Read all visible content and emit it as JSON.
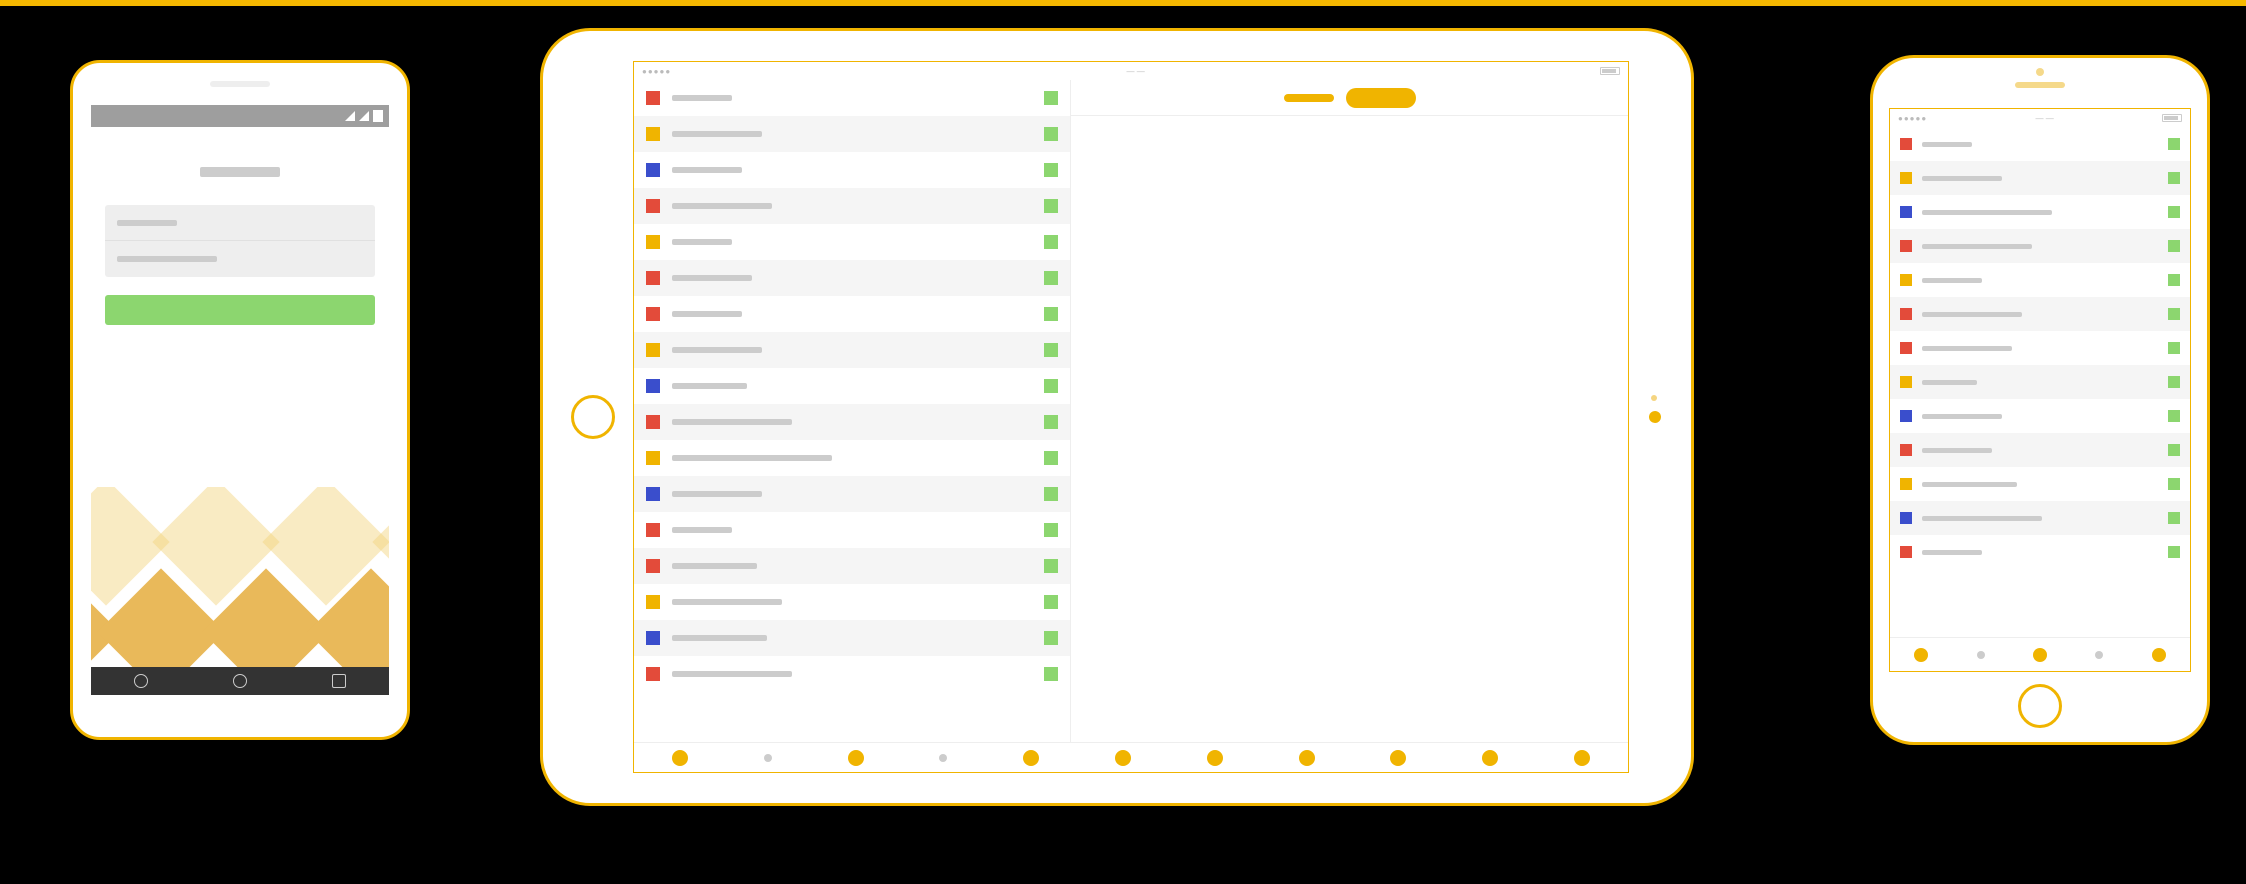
{
  "colors": {
    "accent": "#f0b400",
    "red": "#e34b3a",
    "blue": "#3a4ecc",
    "green": "#8cd66f"
  },
  "tablet": {
    "list": [
      {
        "lead": "red",
        "txtW": 60,
        "alt": false
      },
      {
        "lead": "yellow",
        "txtW": 90,
        "alt": true
      },
      {
        "lead": "blue",
        "txtW": 70,
        "alt": false
      },
      {
        "lead": "red",
        "txtW": 100,
        "alt": true
      },
      {
        "lead": "yellow",
        "txtW": 60,
        "alt": false
      },
      {
        "lead": "red",
        "txtW": 80,
        "alt": true
      },
      {
        "lead": "red",
        "txtW": 70,
        "alt": false
      },
      {
        "lead": "yellow",
        "txtW": 90,
        "alt": true
      },
      {
        "lead": "blue",
        "txtW": 75,
        "alt": false
      },
      {
        "lead": "red",
        "txtW": 120,
        "alt": true
      },
      {
        "lead": "yellow",
        "txtW": 160,
        "alt": false
      },
      {
        "lead": "blue",
        "txtW": 90,
        "alt": true
      },
      {
        "lead": "red",
        "txtW": 60,
        "alt": false
      },
      {
        "lead": "red",
        "txtW": 85,
        "alt": true
      },
      {
        "lead": "yellow",
        "txtW": 110,
        "alt": false
      },
      {
        "lead": "blue",
        "txtW": 95,
        "alt": true
      },
      {
        "lead": "red",
        "txtW": 120,
        "alt": false
      }
    ],
    "tabs": [
      "on",
      "dim",
      "on",
      "dim",
      "on",
      "on",
      "on",
      "on",
      "on",
      "on",
      "on"
    ]
  },
  "iphone": {
    "list": [
      {
        "lead": "red",
        "txtW": 50,
        "alt": false
      },
      {
        "lead": "yellow",
        "txtW": 80,
        "alt": true
      },
      {
        "lead": "blue",
        "txtW": 130,
        "alt": false
      },
      {
        "lead": "red",
        "txtW": 110,
        "alt": true
      },
      {
        "lead": "yellow",
        "txtW": 60,
        "alt": false
      },
      {
        "lead": "red",
        "txtW": 100,
        "alt": true
      },
      {
        "lead": "red",
        "txtW": 90,
        "alt": false
      },
      {
        "lead": "yellow",
        "txtW": 55,
        "alt": true
      },
      {
        "lead": "blue",
        "txtW": 80,
        "alt": false
      },
      {
        "lead": "red",
        "txtW": 70,
        "alt": true
      },
      {
        "lead": "yellow",
        "txtW": 95,
        "alt": false
      },
      {
        "lead": "blue",
        "txtW": 120,
        "alt": true
      },
      {
        "lead": "red",
        "txtW": 60,
        "alt": false
      }
    ],
    "tabs": [
      "on",
      "dim",
      "on",
      "dim",
      "on"
    ]
  }
}
